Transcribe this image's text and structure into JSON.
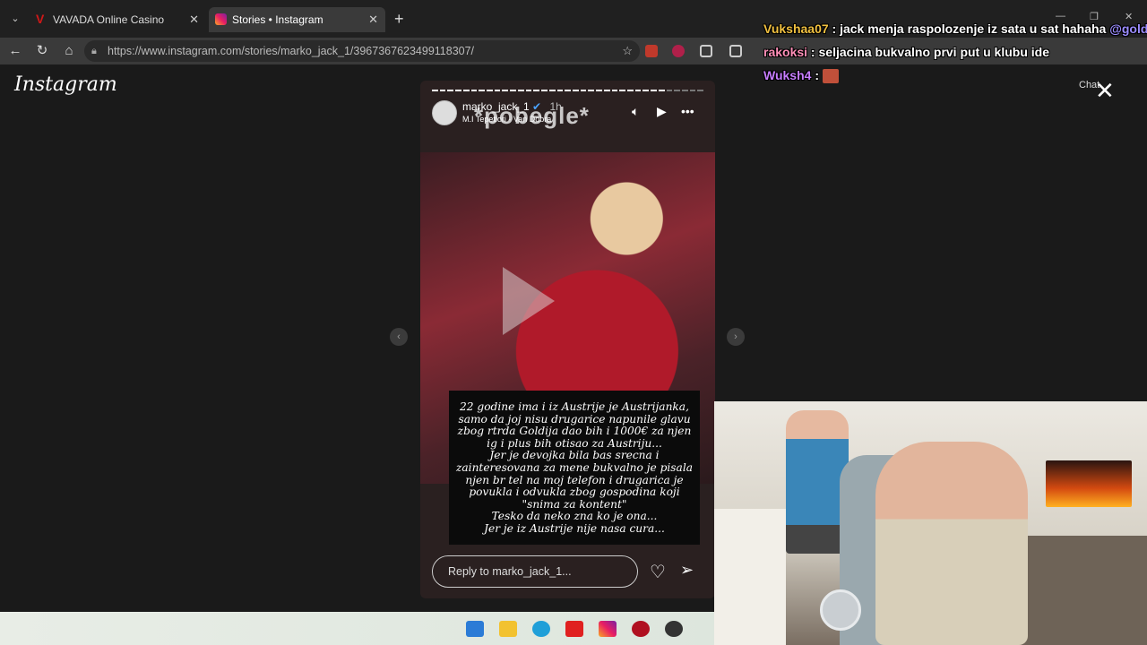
{
  "browser": {
    "tabs": [
      {
        "label": "VAVADA Online Casino",
        "favicon": "vavada-logo-icon"
      },
      {
        "label": "Stories • Instagram",
        "favicon": "instagram-icon"
      }
    ],
    "url": "https://www.instagram.com/stories/marko_jack_1/3967367623499118307/",
    "chat_button": "Chat",
    "new_tab_symbol": "+",
    "accent_color": "#3a3a3a"
  },
  "instagram": {
    "logo": "Instagram",
    "story": {
      "username": "marko_jack_1",
      "verified_mark": "✔",
      "time": "1h",
      "music": "M.I Tepetiori · Van Dobra",
      "overlay_word": "*pobegle*",
      "text_lines": [
        "22 godine ima i iz Austrije je Austrijanka,",
        "samo da joj nisu drugarice napunile glavu",
        "zbog rtrda Goldija dao bih i 1000€ za njen",
        "ig i plus bih otisao za Austriju...",
        "Jer je devojka bila bas srecna i",
        "zainteresovana za mene bukvalno je pisala",
        "njen br tel na moj telefon i drugarica je",
        "povukla i odvukla zbog  gospodina koji",
        "\"snima za kontent\"",
        "Tesko da neko zna ko je ona...",
        "Jer je iz Austrije nije nasa cura..."
      ],
      "reply_placeholder": "Reply to marko_jack_1...",
      "progress_segments_total": 35,
      "progress_segments_viewed": 30
    }
  },
  "chat": [
    {
      "user": "Vukshaa07",
      "user_color": "#f0c040",
      "message": "jack menja raspolozenje iz sata u sat hahaha",
      "mention": "@golde"
    },
    {
      "user": "rakoksi",
      "user_color": "#ff8fb8",
      "message": "seljacina bukvalno prvi put u klubu ide",
      "mention": ""
    },
    {
      "user": "Wuksh4",
      "user_color": "#c77dff",
      "message": "",
      "mention": "",
      "emote": "emote-icon"
    }
  ],
  "taskbar": {
    "icons": [
      "windows-start-icon",
      "file-explorer-icon",
      "edge-icon",
      "youtube-icon",
      "instagram-icon",
      "app-red-icon",
      "chrome-icon"
    ]
  }
}
